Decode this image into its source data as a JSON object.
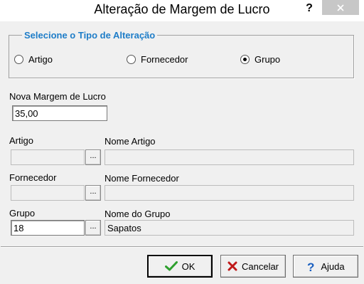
{
  "window": {
    "title": "Alteração de Margem de Lucro",
    "help_glyph": "?"
  },
  "alteration_type": {
    "legend": "Selecione o Tipo de Alteração",
    "options": [
      {
        "label": "Artigo",
        "checked": false
      },
      {
        "label": "Fornecedor",
        "checked": false
      },
      {
        "label": "Grupo",
        "checked": true
      }
    ]
  },
  "margin": {
    "label": "Nova Margem de Lucro",
    "value": "35,00"
  },
  "artigo": {
    "code_label": "Artigo",
    "code_value": "",
    "name_label": "Nome Artigo",
    "name_value": "",
    "lookup_label": "..."
  },
  "fornecedor": {
    "code_label": "Fornecedor",
    "code_value": "",
    "name_label": "Nome Fornecedor",
    "name_value": "",
    "lookup_label": "..."
  },
  "grupo": {
    "code_label": "Grupo",
    "code_value": "18",
    "name_label": "Nome do Grupo",
    "name_value": "Sapatos",
    "lookup_label": "..."
  },
  "buttons": {
    "ok": "OK",
    "cancel": "Cancelar",
    "help": "Ajuda"
  },
  "colors": {
    "legend": "#1e7dc8",
    "ok_icon": "#2ea02e",
    "cancel_icon": "#c01818",
    "help_icon": "#1a5fc0"
  }
}
